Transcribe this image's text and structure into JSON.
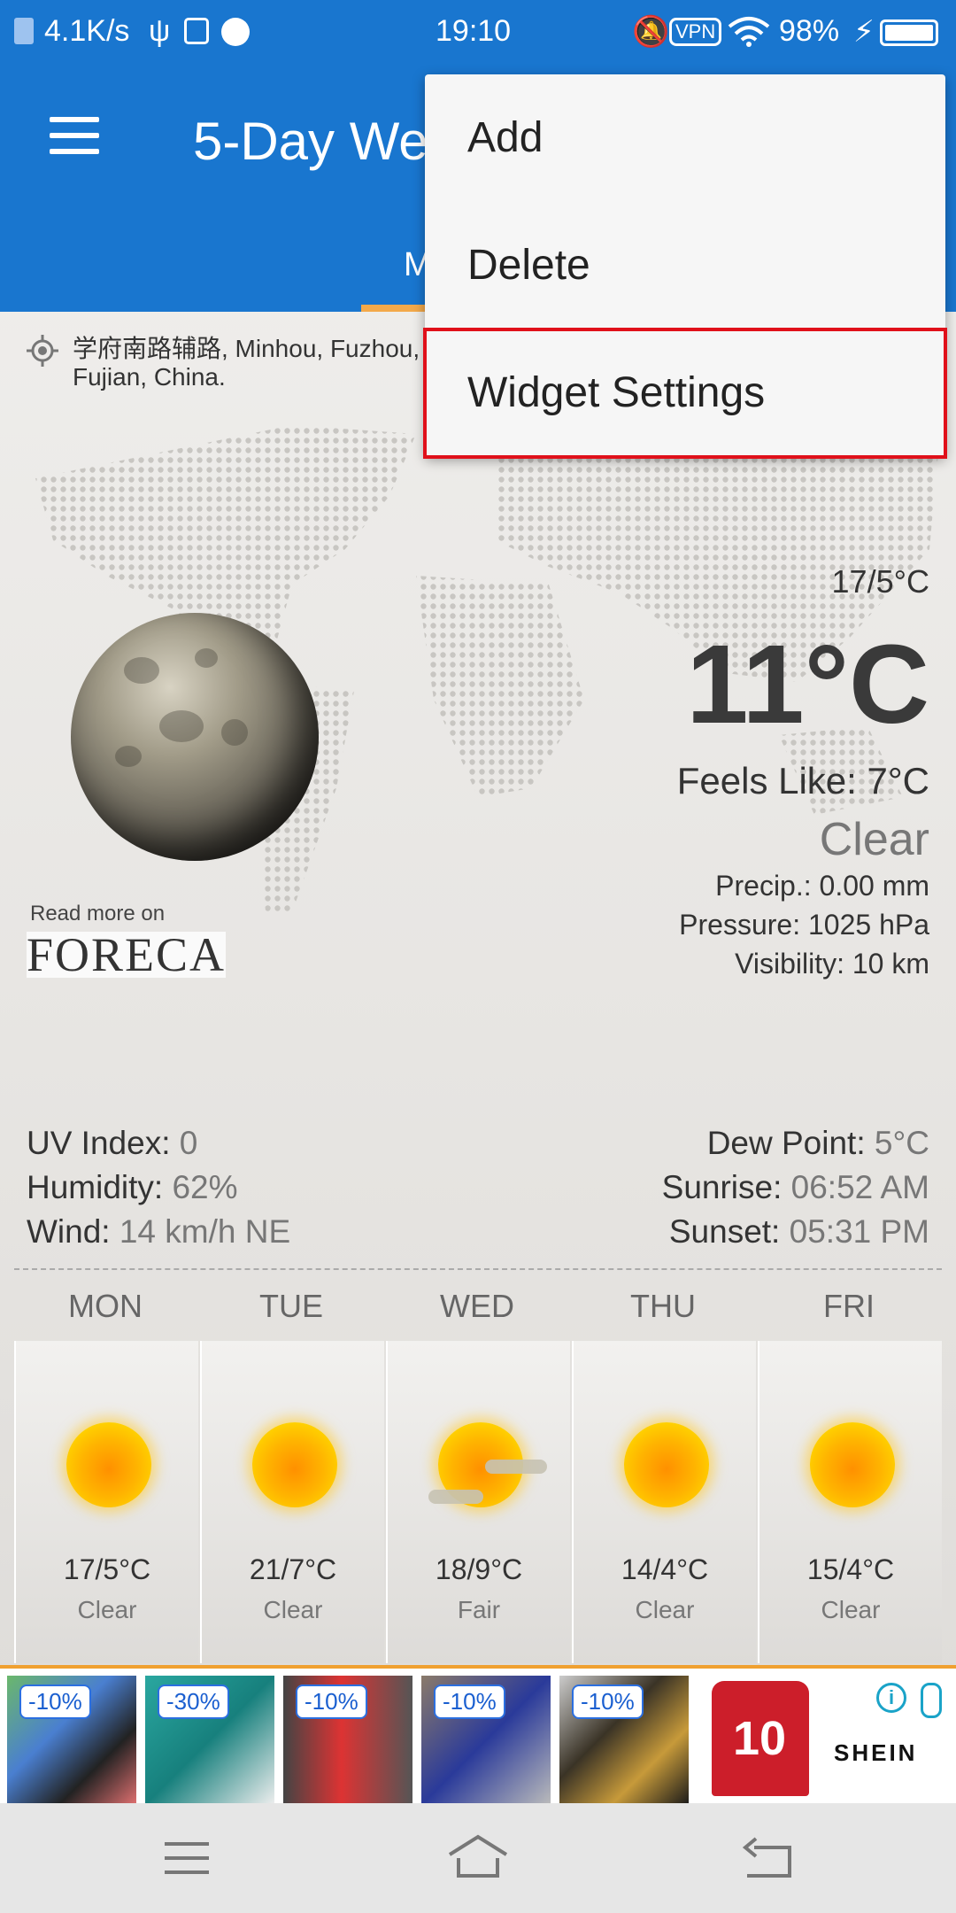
{
  "status_bar": {
    "net_speed": "4.1K/s",
    "time": "19:10",
    "vpn": "VPN",
    "battery": "98%"
  },
  "app_bar": {
    "title": "5-Day Weather",
    "tab": "M"
  },
  "location": {
    "text": "学府南路辅路, Minhou, Fuzhou, Fujian, China."
  },
  "current": {
    "hilo": "17/5°C",
    "temp": "11°C",
    "feels_like": "Feels Like: 7°C",
    "condition": "Clear",
    "precip": "Precip.: 0.00 mm",
    "pressure": "Pressure: 1025 hPa",
    "visibility": "Visibility: 10 km"
  },
  "branding": {
    "read_more": "Read more on",
    "logo": "FORECA"
  },
  "details": {
    "uv_label": "UV Index:",
    "uv_value": "0",
    "humidity_label": "Humidity:",
    "humidity_value": "62%",
    "wind_label": "Wind:",
    "wind_value": "14 km/h NE",
    "dew_label": "Dew Point:",
    "dew_value": "5°C",
    "sunrise_label": "Sunrise:",
    "sunrise_value": "06:52 AM",
    "sunset_label": "Sunset:",
    "sunset_value": "05:31 PM"
  },
  "forecast": [
    {
      "day": "MON",
      "temp": "17/5°C",
      "cond": "Clear",
      "icon": "sun-icon"
    },
    {
      "day": "TUE",
      "temp": "21/7°C",
      "cond": "Clear",
      "icon": "sun-icon"
    },
    {
      "day": "WED",
      "temp": "18/9°C",
      "cond": "Fair",
      "icon": "partly-cloudy-icon"
    },
    {
      "day": "THU",
      "temp": "14/4°C",
      "cond": "Clear",
      "icon": "sun-icon"
    },
    {
      "day": "FRI",
      "temp": "15/4°C",
      "cond": "Clear",
      "icon": "sun-icon"
    }
  ],
  "ad": {
    "badges": [
      "-10%",
      "-30%",
      "-10%",
      "-10%",
      "-10%"
    ],
    "jersey_number": "10",
    "brand": "SHEIN"
  },
  "dropdown": {
    "items": [
      "Add",
      "Delete",
      "Widget Settings"
    ],
    "highlighted": "Widget Settings"
  },
  "colors": {
    "primary": "#1976cf",
    "tab_indicator": "#f3a94a",
    "highlight_border": "#e0101a"
  }
}
